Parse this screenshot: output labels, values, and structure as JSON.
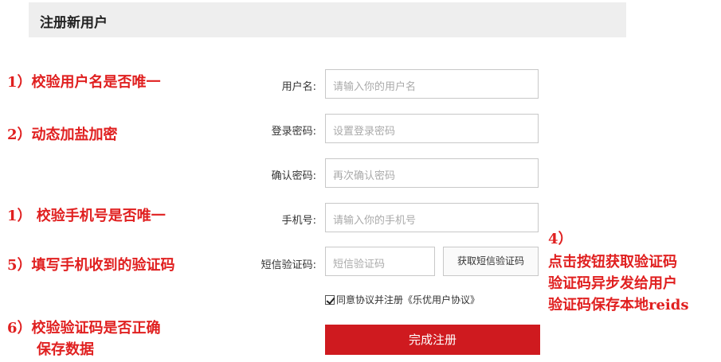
{
  "header": {
    "title": "注册新用户"
  },
  "form": {
    "username": {
      "label": "用户名:",
      "placeholder": "请输入你的用户名"
    },
    "password": {
      "label": "登录密码:",
      "placeholder": "设置登录密码"
    },
    "confirm_password": {
      "label": "确认密码:",
      "placeholder": "再次确认密码"
    },
    "phone": {
      "label": "手机号:",
      "placeholder": "请输入你的手机号"
    },
    "sms_code": {
      "label": "短信验证码:",
      "placeholder": "短信验证码",
      "button_label": "获取短信验证码"
    },
    "agreement": {
      "text": "同意协议并注册《乐优用户协议》",
      "checked": true
    },
    "submit_label": "完成注册"
  },
  "annotations": {
    "note1": "1）校验用户名是否唯一",
    "note2": "2）动态加盐加密",
    "note3": "1） 校验手机号是否唯一",
    "note4_line1": "4）",
    "note4_line2": "点击按钮获取验证码",
    "note4_line3": "验证码异步发给用户",
    "note4_line4": "验证码保存本地reids",
    "note5": "5）填写手机收到的验证码",
    "note6_line1": "6）校验验证码是否正确",
    "note6_line2": "保存数据"
  },
  "colors": {
    "accent": "#cf1a1f",
    "annotation": "#e02020",
    "header_bg": "#eeeeee"
  }
}
